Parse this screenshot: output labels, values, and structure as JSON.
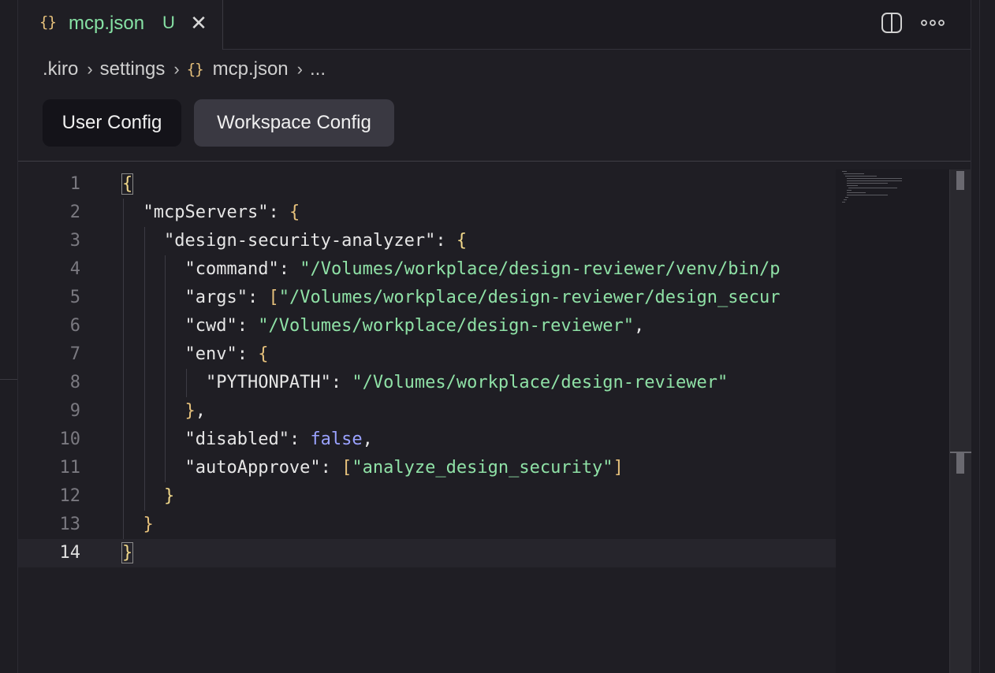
{
  "tab": {
    "icon": "{}",
    "filename": "mcp.json",
    "status": "U",
    "close": "✕"
  },
  "breadcrumb": {
    "items": [
      ".kiro",
      "settings",
      "mcp.json",
      "..."
    ],
    "json_icon": "{}"
  },
  "config_tabs": {
    "user": "User Config",
    "workspace": "Workspace Config",
    "selected": "Workspace Config"
  },
  "editor": {
    "active_line": 14,
    "line_numbers": [
      "1",
      "2",
      "3",
      "4",
      "5",
      "6",
      "7",
      "8",
      "9",
      "10",
      "11",
      "12",
      "13",
      "14"
    ],
    "lines": [
      [
        {
          "t": "{",
          "c": "b1"
        }
      ],
      [
        {
          "t": "  ",
          "c": "p"
        },
        {
          "t": "\"mcpServers\"",
          "c": "k"
        },
        {
          "t": ": ",
          "c": "p"
        },
        {
          "t": "{",
          "c": "b2"
        }
      ],
      [
        {
          "t": "    ",
          "c": "p"
        },
        {
          "t": "\"design-security-analyzer\"",
          "c": "k"
        },
        {
          "t": ": ",
          "c": "p"
        },
        {
          "t": "{",
          "c": "b1"
        }
      ],
      [
        {
          "t": "      ",
          "c": "p"
        },
        {
          "t": "\"command\"",
          "c": "k"
        },
        {
          "t": ": ",
          "c": "p"
        },
        {
          "t": "\"/Volumes/workplace/design-reviewer/venv/bin/p",
          "c": "s"
        }
      ],
      [
        {
          "t": "      ",
          "c": "p"
        },
        {
          "t": "\"args\"",
          "c": "k"
        },
        {
          "t": ": ",
          "c": "p"
        },
        {
          "t": "[",
          "c": "b2"
        },
        {
          "t": "\"/Volumes/workplace/design-reviewer/design_secur",
          "c": "s"
        }
      ],
      [
        {
          "t": "      ",
          "c": "p"
        },
        {
          "t": "\"cwd\"",
          "c": "k"
        },
        {
          "t": ": ",
          "c": "p"
        },
        {
          "t": "\"/Volumes/workplace/design-reviewer\"",
          "c": "s"
        },
        {
          "t": ",",
          "c": "p"
        }
      ],
      [
        {
          "t": "      ",
          "c": "p"
        },
        {
          "t": "\"env\"",
          "c": "k"
        },
        {
          "t": ": ",
          "c": "p"
        },
        {
          "t": "{",
          "c": "b2"
        }
      ],
      [
        {
          "t": "        ",
          "c": "p"
        },
        {
          "t": "\"PYTHONPATH\"",
          "c": "k"
        },
        {
          "t": ": ",
          "c": "p"
        },
        {
          "t": "\"/Volumes/workplace/design-reviewer\"",
          "c": "s"
        }
      ],
      [
        {
          "t": "      ",
          "c": "p"
        },
        {
          "t": "}",
          "c": "b2"
        },
        {
          "t": ",",
          "c": "p"
        }
      ],
      [
        {
          "t": "      ",
          "c": "p"
        },
        {
          "t": "\"disabled\"",
          "c": "k"
        },
        {
          "t": ": ",
          "c": "p"
        },
        {
          "t": "false",
          "c": "kw"
        },
        {
          "t": ",",
          "c": "p"
        }
      ],
      [
        {
          "t": "      ",
          "c": "p"
        },
        {
          "t": "\"autoApprove\"",
          "c": "k"
        },
        {
          "t": ": ",
          "c": "p"
        },
        {
          "t": "[",
          "c": "b2"
        },
        {
          "t": "\"analyze_design_security\"",
          "c": "s"
        },
        {
          "t": "]",
          "c": "b2"
        }
      ],
      [
        {
          "t": "    ",
          "c": "p"
        },
        {
          "t": "}",
          "c": "b1"
        }
      ],
      [
        {
          "t": "  ",
          "c": "p"
        },
        {
          "t": "}",
          "c": "b2"
        }
      ],
      [
        {
          "t": "}",
          "c": "b1"
        }
      ]
    ]
  },
  "icons": {
    "split": "split-editor-icon",
    "more": "more-actions-icon",
    "chevron": "chevron-right-icon"
  },
  "colors": {
    "accent_green": "#86e1a4",
    "brace_yellow": "#e5c07b",
    "keyword_blue": "#9aa2ff"
  }
}
